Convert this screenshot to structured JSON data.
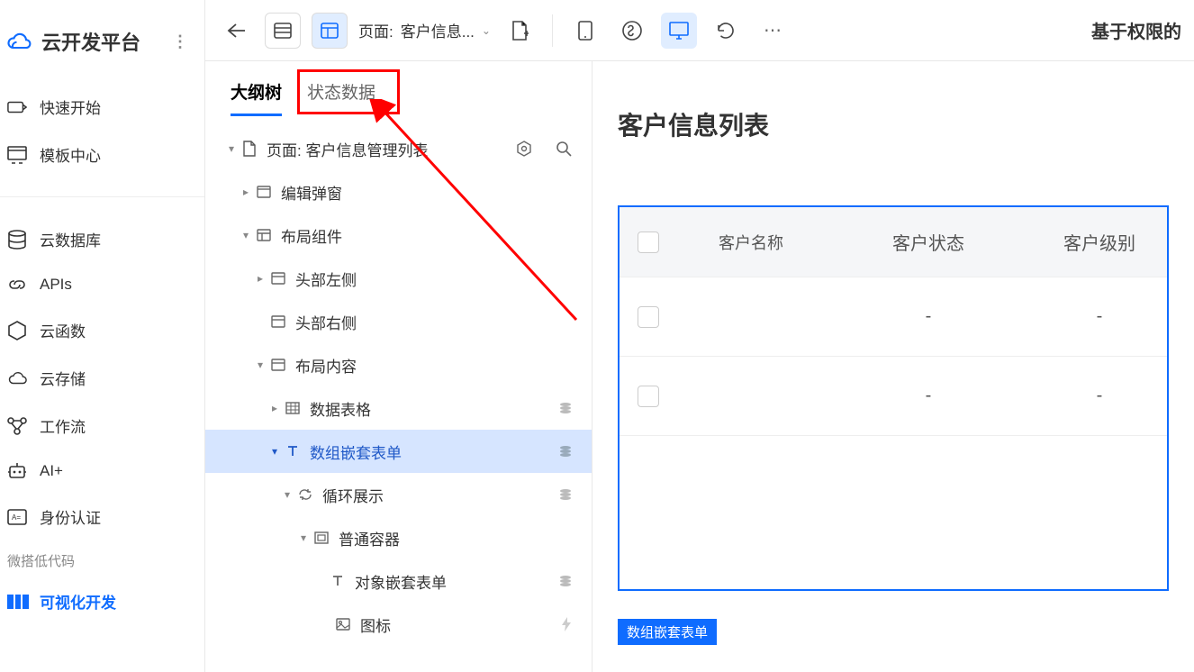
{
  "brand": {
    "title": "云开发平台"
  },
  "sidebar": {
    "items": [
      {
        "label": "快速开始"
      },
      {
        "label": "模板中心"
      },
      {
        "label": "云数据库"
      },
      {
        "label": "APIs"
      },
      {
        "label": "云函数"
      },
      {
        "label": "云存储"
      },
      {
        "label": "工作流"
      },
      {
        "label": "AI+"
      },
      {
        "label": "身份认证"
      }
    ],
    "group_label": "微搭低代码",
    "active_item": "可视化开发"
  },
  "topbar": {
    "page_label_prefix": "页面:",
    "page_label_value": "客户信息...",
    "right_text": "基于权限的"
  },
  "outline": {
    "tabs": [
      {
        "label": "大纲树",
        "active": true
      },
      {
        "label": "状态数据",
        "active": false
      }
    ],
    "root_prefix": "页面:",
    "root_label": "客户信息管理列表",
    "nodes": {
      "edit_modal": "编辑弹窗",
      "layout": "布局组件",
      "head_left": "头部左侧",
      "head_right": "头部右侧",
      "layout_content": "布局内容",
      "data_table": "数据表格",
      "array_form": "数组嵌套表单",
      "loop": "循环展示",
      "container": "普通容器",
      "obj_form": "对象嵌套表单",
      "icon": "图标"
    }
  },
  "canvas": {
    "title": "客户信息列表",
    "columns": [
      "客户名称",
      "客户状态",
      "客户级别"
    ],
    "row_placeholder": "-",
    "selection_chip": "数组嵌套表单"
  }
}
